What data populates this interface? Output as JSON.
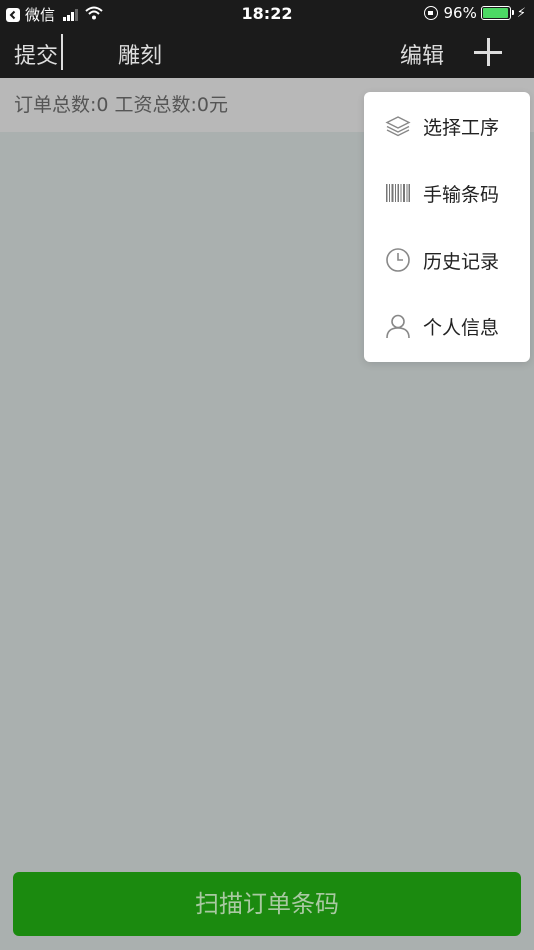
{
  "status_bar": {
    "back_app": "微信",
    "time": "18:22",
    "battery_percent": "96%",
    "battery_level": 0.96
  },
  "nav": {
    "submit_label": "提交",
    "title": "雕刻",
    "edit_label": "编辑"
  },
  "summary": {
    "text": "订单总数:0 工资总数:0元"
  },
  "menu": {
    "items": [
      {
        "label": "选择工序",
        "icon": "layers-icon"
      },
      {
        "label": "手输条码",
        "icon": "barcode-icon"
      },
      {
        "label": "历史记录",
        "icon": "clock-icon"
      },
      {
        "label": "个人信息",
        "icon": "person-icon"
      }
    ]
  },
  "bottom": {
    "scan_label": "扫描订单条码"
  },
  "colors": {
    "nav_bg": "#1b1b1b",
    "page_bg": "#aab0af",
    "button_bg": "#1b8a0f",
    "battery": "#4cd964"
  }
}
